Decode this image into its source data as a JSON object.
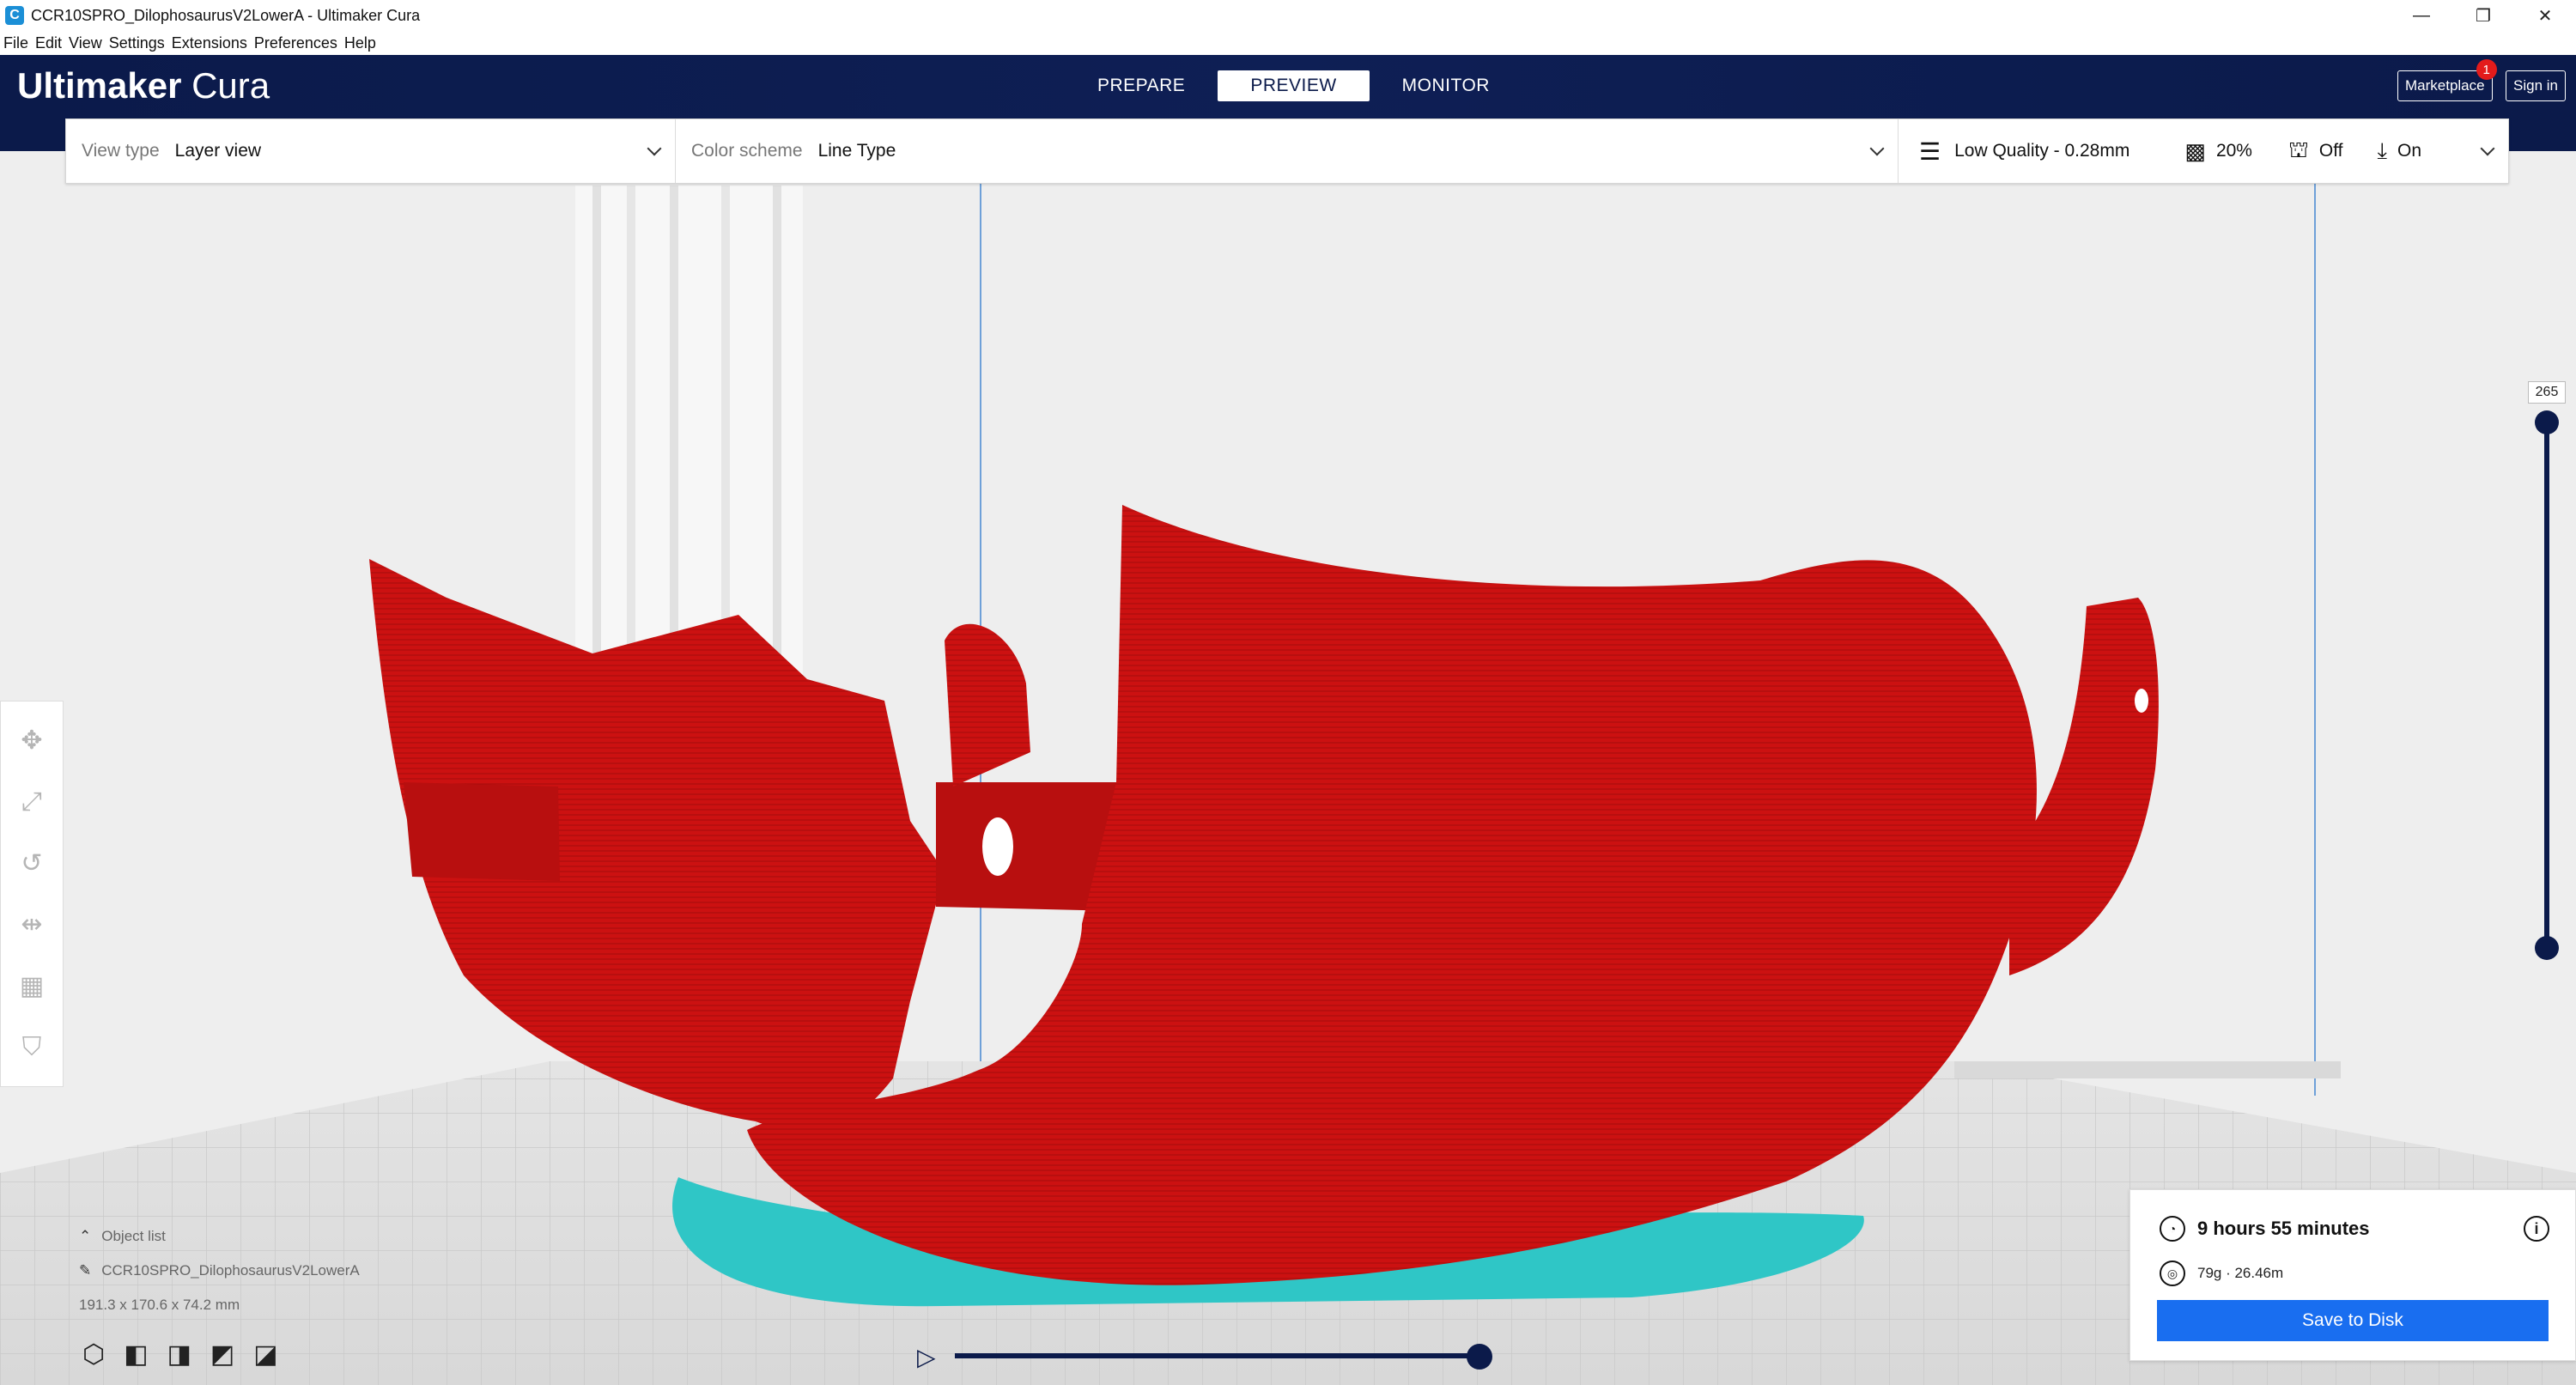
{
  "window": {
    "title": "CCR10SPRO_DilophosaurusV2LowerA - Ultimaker Cura",
    "app_icon": "C",
    "controls": [
      "—",
      "❐",
      "✕"
    ]
  },
  "menu": [
    "File",
    "Edit",
    "View",
    "Settings",
    "Extensions",
    "Preferences",
    "Help"
  ],
  "header": {
    "logo_bold": "Ultimaker",
    "logo_light": "Cura",
    "tabs": [
      {
        "label": "PREPARE",
        "active": false
      },
      {
        "label": "PREVIEW",
        "active": true
      },
      {
        "label": "MONITOR",
        "active": false
      }
    ],
    "marketplace_label": "Marketplace",
    "marketplace_badge": "1",
    "signin_label": "Sign in"
  },
  "toolbar": {
    "view_type_label": "View type",
    "view_type_value": "Layer view",
    "color_scheme_label": "Color scheme",
    "color_scheme_value": "Line Type",
    "quality": "Low Quality - 0.28mm",
    "infill": "20%",
    "support": "Off",
    "adhesion": "On"
  },
  "layer_slider": {
    "current_layer": "265",
    "top_fraction": 1.0,
    "bottom_fraction": 0.0
  },
  "object_list": {
    "header": "Object list",
    "object_name": "CCR10SPRO_DilophosaurusV2LowerA",
    "dimensions": "191.3 x 170.6 x 74.2 mm"
  },
  "print_info": {
    "time": "9 hours 55 minutes",
    "material": "79g · 26.46m",
    "save_label": "Save to Disk"
  },
  "colors": {
    "header": "#0b1a4a",
    "model": "#cc1111",
    "skirt": "#2fc6c6",
    "save_button": "#196ef0",
    "badge": "#e31b1b"
  }
}
